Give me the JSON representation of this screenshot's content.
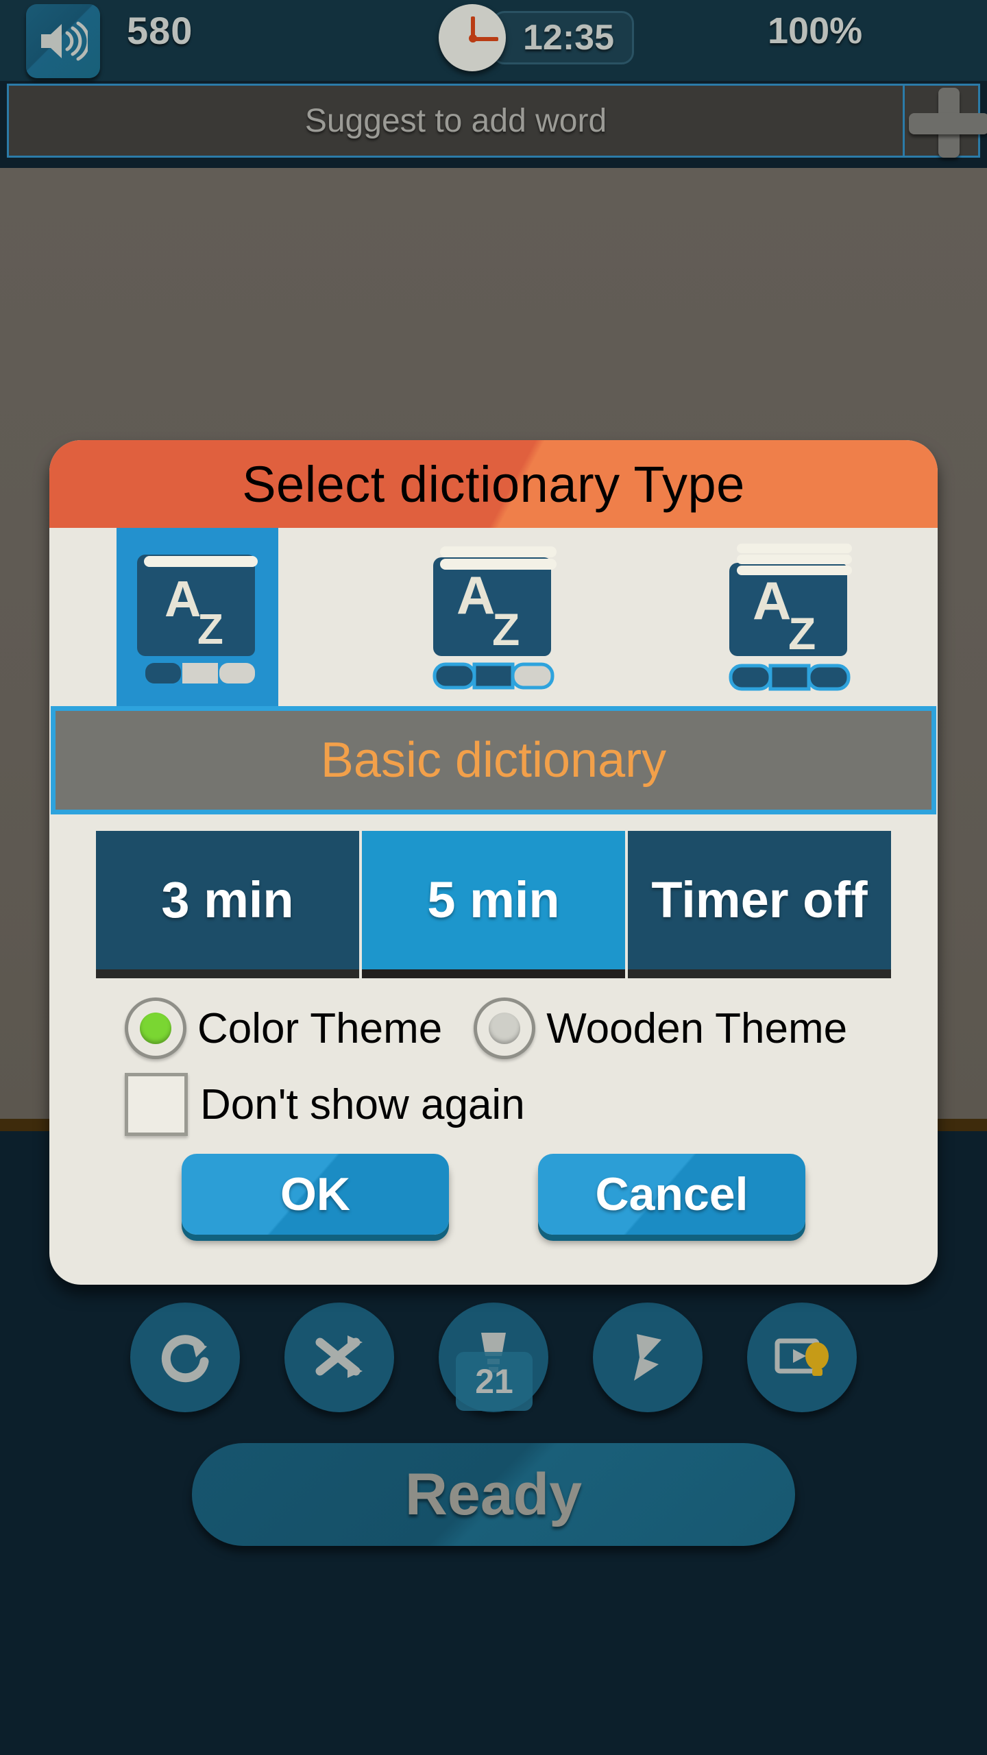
{
  "statusbar": {
    "speaker_icon": "speaker-volume-icon",
    "score": "580",
    "clock_icon": "analog-clock-icon",
    "time": "12:35",
    "battery": "100%"
  },
  "suggest": {
    "placeholder": "Suggest to add word",
    "add_icon": "plus-icon"
  },
  "dialog": {
    "title": "Select dictionary Type",
    "dictionary_options": [
      {
        "name": "dictionary-book-basic",
        "level": 1,
        "selected": true
      },
      {
        "name": "dictionary-book-medium",
        "level": 2,
        "selected": false
      },
      {
        "name": "dictionary-book-full",
        "level": 3,
        "selected": false
      }
    ],
    "selected_label": "Basic dictionary",
    "timer_options": [
      {
        "label": "3 min",
        "active": false
      },
      {
        "label": "5 min",
        "active": true
      },
      {
        "label": "Timer off",
        "active": false
      }
    ],
    "themes": [
      {
        "label": "Color Theme",
        "checked": true
      },
      {
        "label": "Wooden Theme",
        "checked": false
      }
    ],
    "dont_show_again": {
      "label": "Don't show again",
      "checked": false
    },
    "ok_label": "OK",
    "cancel_label": "Cancel",
    "accent_orange": "#ef7f4a",
    "accent_blue": "#2ea3dd",
    "label_text_color": "#f2a04a",
    "radio_on_color": "#7ad632"
  },
  "toolbar": {
    "items": [
      {
        "icon": "refresh-rotate-icon",
        "badge": ""
      },
      {
        "icon": "shuffle-icon",
        "badge": ""
      },
      {
        "icon": "trophy-icon",
        "badge": "21"
      },
      {
        "icon": "flag-icon",
        "badge": ""
      },
      {
        "icon": "video-hint-icon",
        "badge": ""
      }
    ]
  },
  "ready_button": {
    "label": "Ready"
  }
}
